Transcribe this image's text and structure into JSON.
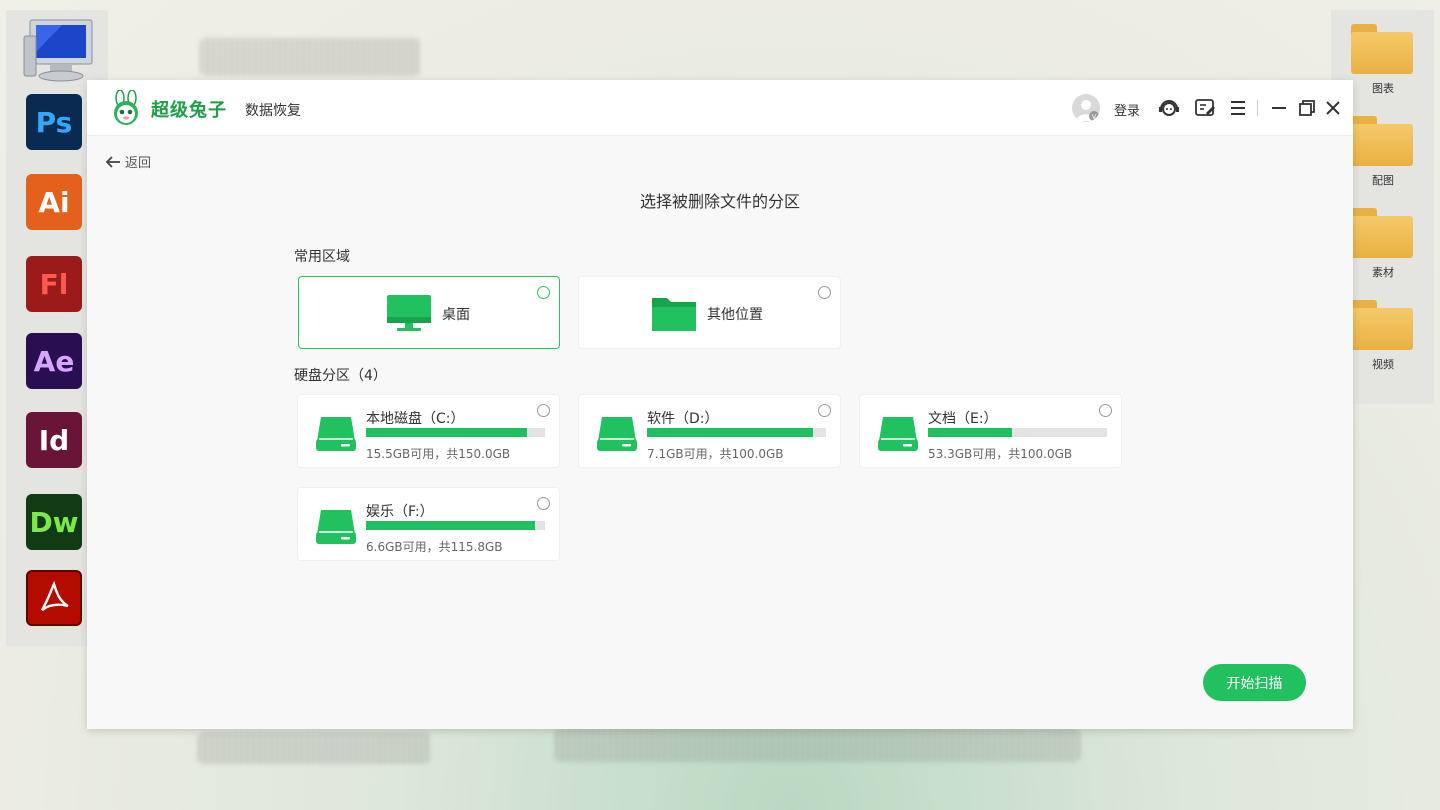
{
  "desktop": {
    "left_dock_apps": [
      {
        "label": "Ps",
        "bg": "#0a2a52",
        "fg": "#31a8ff"
      },
      {
        "label": "Ai",
        "bg": "#e3611c",
        "fg": "#ffffff"
      },
      {
        "label": "Fl",
        "bg": "#9b1b1b",
        "fg": "#ff5a50"
      },
      {
        "label": "Ae",
        "bg": "#2a0e52",
        "fg": "#d6a6ff"
      },
      {
        "label": "Id",
        "bg": "#6a1438",
        "fg": "#ffffff"
      },
      {
        "label": "Dw",
        "bg": "#123a14",
        "fg": "#7ee84a"
      }
    ],
    "right_folders": [
      "图表",
      "配图",
      "素材",
      "视频"
    ]
  },
  "app": {
    "brand": "超级兔子",
    "brand_sub": "数据恢复",
    "login_label": "登录",
    "back_label": "返回",
    "page_title": "选择被删除文件的分区",
    "common_section": "常用区域",
    "locations": [
      {
        "label": "桌面",
        "selected": true
      },
      {
        "label": "其他位置",
        "selected": false
      }
    ],
    "disk_section": "硬盘分区（4）",
    "drives": [
      {
        "name": "本地磁盘（C:）",
        "free": "15.5GB可用，共150.0GB",
        "used_fraction": 0.897
      },
      {
        "name": "软件（D:）",
        "free": "7.1GB可用，共100.0GB",
        "used_fraction": 0.929
      },
      {
        "name": "文档（E:）",
        "free": "53.3GB可用，共100.0GB",
        "used_fraction": 0.467
      },
      {
        "name": "娱乐（F:）",
        "free": "6.6GB可用，共115.8GB",
        "used_fraction": 0.943
      }
    ],
    "scan_button": "开始扫描"
  },
  "colors": {
    "accent": "#22c160",
    "brand": "#1e9e46"
  }
}
